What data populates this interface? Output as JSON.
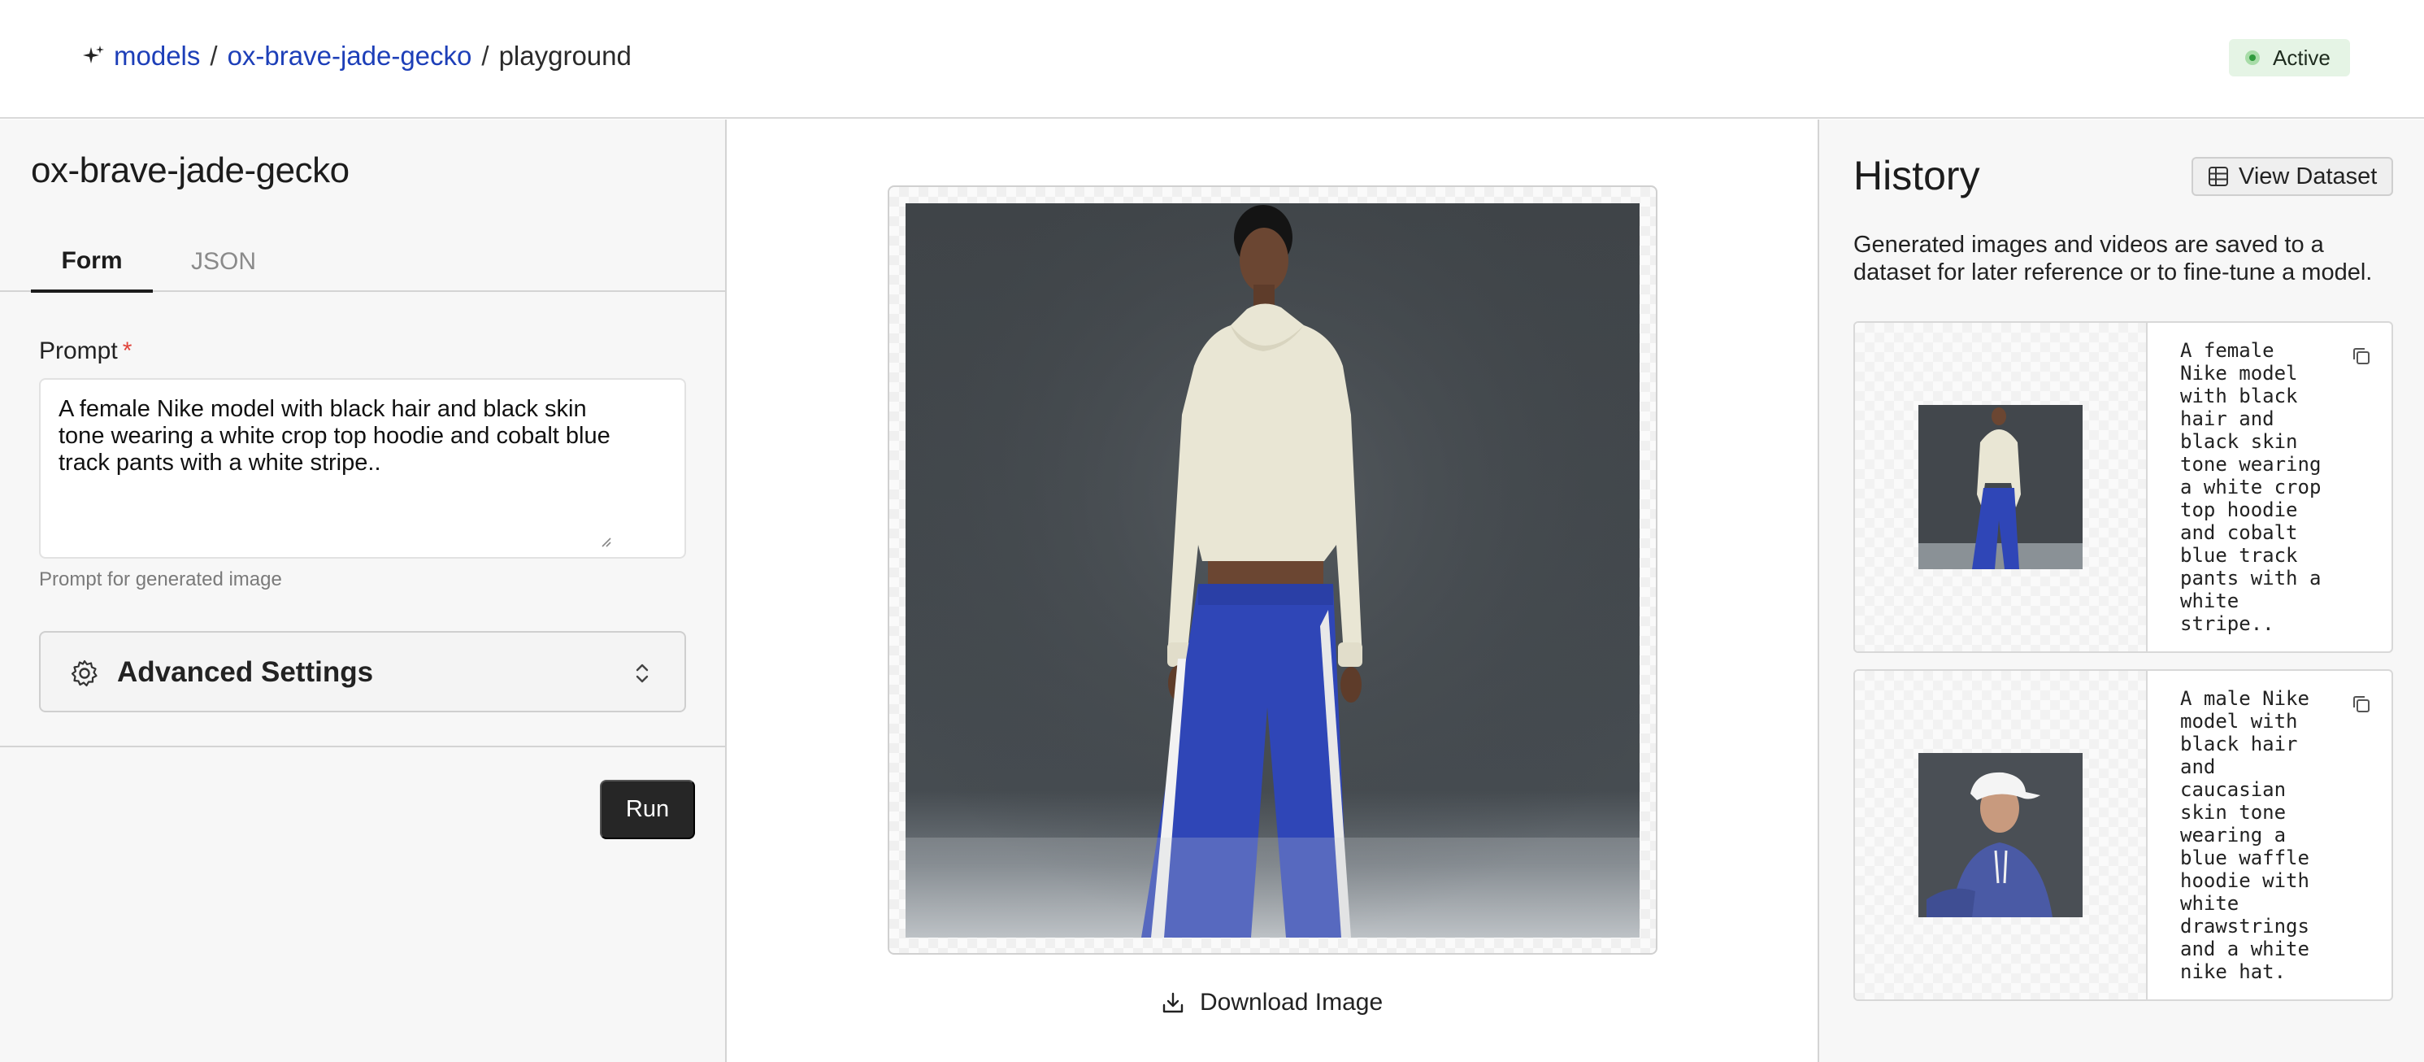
{
  "header": {
    "breadcrumb": {
      "root": "models",
      "sep1": "/",
      "model": "ox-brave-jade-gecko",
      "sep2": "/",
      "current": "playground"
    },
    "status": "Active",
    "status_color": "#2f9a3c"
  },
  "left_panel": {
    "title": "ox-brave-jade-gecko",
    "tabs": [
      {
        "label": "Form",
        "active": true
      },
      {
        "label": "JSON",
        "active": false
      }
    ],
    "prompt": {
      "label": "Prompt",
      "required_mark": "*",
      "value": "A female Nike model with black hair and black skin tone wearing a white crop top hoodie and cobalt blue track pants with a white stripe..",
      "helper": "Prompt for generated image"
    },
    "advanced_settings_label": "Advanced Settings",
    "run_label": "Run"
  },
  "center": {
    "image_alt": "Generated image: female model in cream cropped hoodie and cobalt blue track pants",
    "download_label": "Download Image"
  },
  "history": {
    "title": "History",
    "view_dataset_label": "View Dataset",
    "description": "Generated images and videos are saved to a dataset for later reference or to fine-tune a model.",
    "items": [
      {
        "caption": "A female\nNike model\nwith black\nhair and\nblack skin\ntone wearing\na white crop\ntop hoodie\nand cobalt\nblue track\npants with a\nwhite\nstripe.."
      },
      {
        "caption": "A male Nike\nmodel with\nblack hair\nand\ncaucasian\nskin tone\nwearing a\nblue waffle\nhoodie with\nwhite\ndrawstrings\nand a white\nnike hat."
      }
    ]
  },
  "colors": {
    "link": "#1d3fb8",
    "run_button": "#262626",
    "badge_bg": "#e5f4e5",
    "required": "#e0433a"
  },
  "icons": [
    "sparkle-icon",
    "gear-icon",
    "chevron-up-down-icon",
    "download-icon",
    "table-icon",
    "copy-icon"
  ]
}
